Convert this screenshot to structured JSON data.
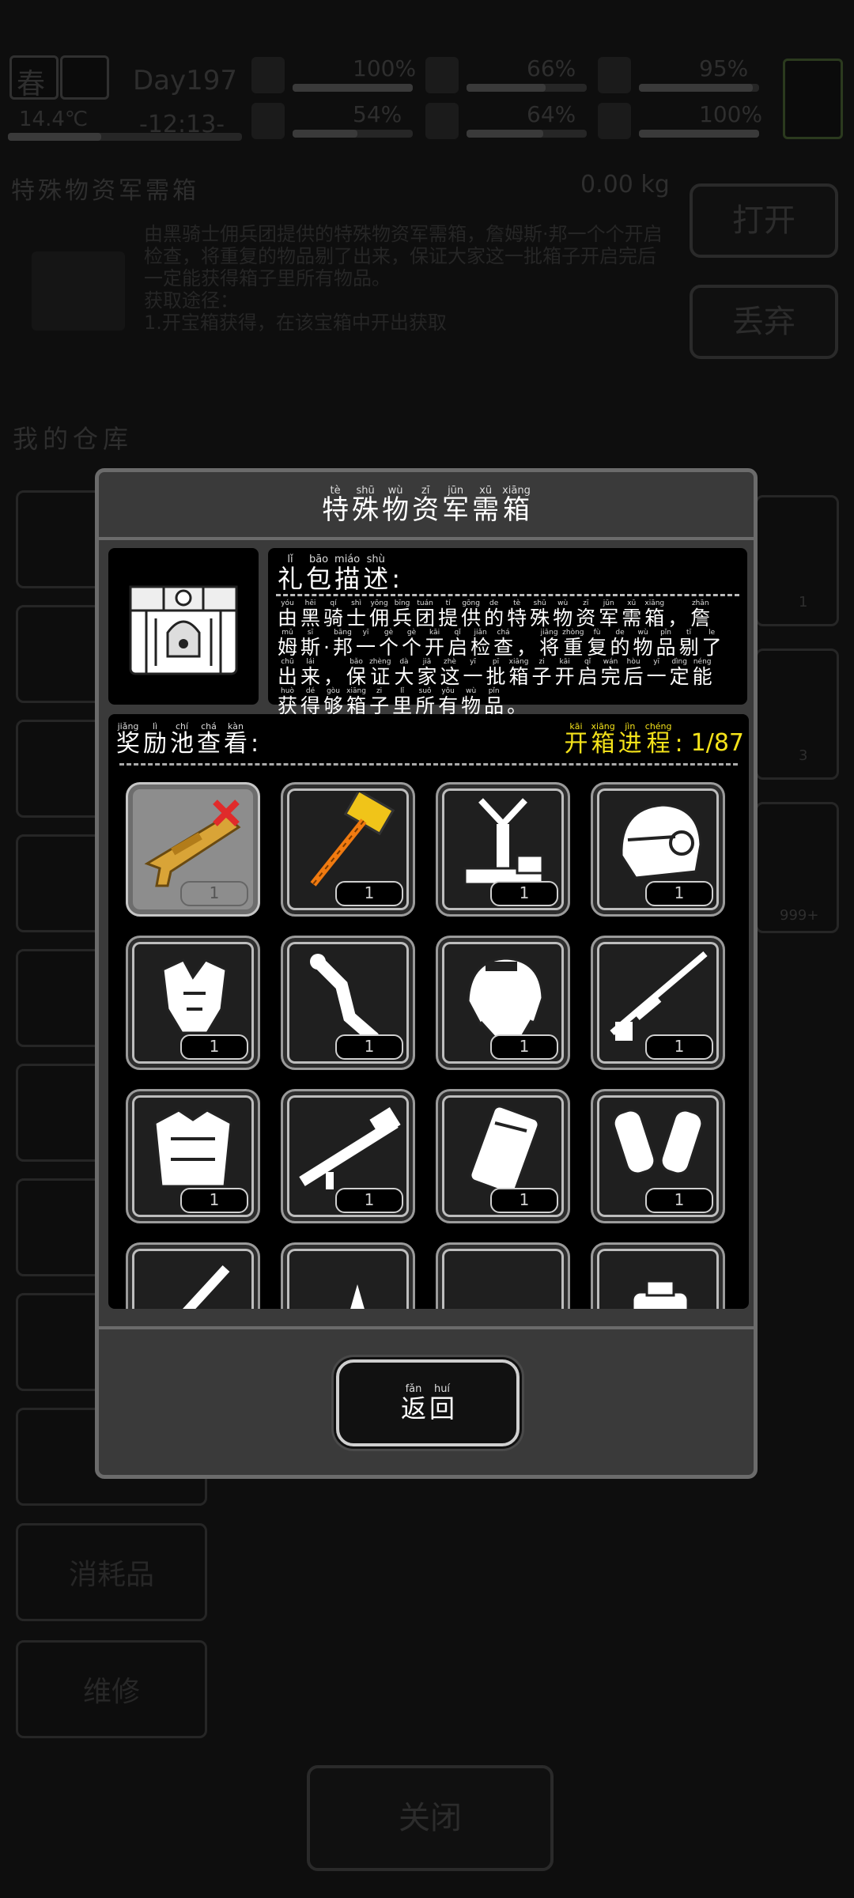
{
  "hud": {
    "season": "春",
    "day": "Day197",
    "temperature": "14.4℃",
    "time": "-12:13-",
    "stats": [
      {
        "name": "health",
        "value": "100%",
        "level": 1.0
      },
      {
        "name": "food",
        "value": "66%",
        "level": 0.66
      },
      {
        "name": "mood",
        "value": "95%",
        "level": 0.95
      },
      {
        "name": "stamina",
        "value": "54%",
        "level": 0.54
      },
      {
        "name": "water",
        "value": "64%",
        "level": 0.64
      },
      {
        "name": "heart",
        "value": "100%",
        "level": 1.0
      }
    ]
  },
  "background": {
    "item_title": "特殊物资军需箱",
    "weight": "0.00 kg",
    "open_button": "打开",
    "discard_button": "丢弃",
    "description": "由黑骑士佣兵团提供的特殊物资军需箱，詹姆斯·邦一个个开启检查，将重复的物品剔了出来，保证大家这一批箱子开启完后一定能获得箱子里所有物品。",
    "source_label": "获取途径：",
    "source_text": "1.开宝箱获得，在该宝箱中开出获取",
    "warehouse_title": "我的仓库",
    "side_items": [
      "消耗品",
      "维修"
    ],
    "right_badges": [
      "1",
      "3",
      "999+"
    ],
    "close_button": "关闭"
  },
  "modal": {
    "title": [
      {
        "py": "tè",
        "hz": "特"
      },
      {
        "py": "shū",
        "hz": "殊"
      },
      {
        "py": "wù",
        "hz": "物"
      },
      {
        "py": "zī",
        "hz": "资"
      },
      {
        "py": "jūn",
        "hz": "军"
      },
      {
        "py": "xū",
        "hz": "需"
      },
      {
        "py": "xiāng",
        "hz": "箱"
      }
    ],
    "desc_label": [
      {
        "py": "lǐ",
        "hz": "礼"
      },
      {
        "py": "bāo",
        "hz": "包"
      },
      {
        "py": "miáo",
        "hz": "描"
      },
      {
        "py": "shù",
        "hz": "述"
      },
      {
        "py": "",
        "hz": ":"
      }
    ],
    "description_lines": [
      [
        {
          "py": "yóu",
          "hz": "由"
        },
        {
          "py": "hēi",
          "hz": "黑"
        },
        {
          "py": "qí",
          "hz": "骑"
        },
        {
          "py": "shì",
          "hz": "士"
        },
        {
          "py": "yōng",
          "hz": "佣"
        },
        {
          "py": "bīng",
          "hz": "兵"
        },
        {
          "py": "tuán",
          "hz": "团"
        },
        {
          "py": "tí",
          "hz": "提"
        },
        {
          "py": "gōng",
          "hz": "供"
        },
        {
          "py": "de",
          "hz": "的"
        },
        {
          "py": "tè",
          "hz": "特"
        },
        {
          "py": "shū",
          "hz": "殊"
        },
        {
          "py": "wù",
          "hz": "物"
        },
        {
          "py": "zī",
          "hz": "资"
        },
        {
          "py": "jūn",
          "hz": "军"
        },
        {
          "py": "xū",
          "hz": "需"
        },
        {
          "py": "xiāng",
          "hz": "箱"
        },
        {
          "py": "",
          "hz": "，"
        },
        {
          "py": "zhān",
          "hz": "詹"
        }
      ],
      [
        {
          "py": "mǔ",
          "hz": "姆"
        },
        {
          "py": "sī",
          "hz": "斯"
        },
        {
          "py": "",
          "hz": "·"
        },
        {
          "py": "bāng",
          "hz": "邦"
        },
        {
          "py": "yī",
          "hz": "一"
        },
        {
          "py": "gè",
          "hz": "个"
        },
        {
          "py": "gè",
          "hz": "个"
        },
        {
          "py": "kāi",
          "hz": "开"
        },
        {
          "py": "qǐ",
          "hz": "启"
        },
        {
          "py": "jiǎn",
          "hz": "检"
        },
        {
          "py": "chá",
          "hz": "查"
        },
        {
          "py": "",
          "hz": "，"
        },
        {
          "py": "jiāng",
          "hz": "将"
        },
        {
          "py": "zhòng",
          "hz": "重"
        },
        {
          "py": "fù",
          "hz": "复"
        },
        {
          "py": "de",
          "hz": "的"
        },
        {
          "py": "wù",
          "hz": "物"
        },
        {
          "py": "pǐn",
          "hz": "品"
        },
        {
          "py": "tī",
          "hz": "剔"
        },
        {
          "py": "le",
          "hz": "了"
        }
      ],
      [
        {
          "py": "chū",
          "hz": "出"
        },
        {
          "py": "lái",
          "hz": "来"
        },
        {
          "py": "",
          "hz": "，"
        },
        {
          "py": "bǎo",
          "hz": "保"
        },
        {
          "py": "zhèng",
          "hz": "证"
        },
        {
          "py": "dà",
          "hz": "大"
        },
        {
          "py": "jiā",
          "hz": "家"
        },
        {
          "py": "zhè",
          "hz": "这"
        },
        {
          "py": "yī",
          "hz": "一"
        },
        {
          "py": "pī",
          "hz": "批"
        },
        {
          "py": "xiāng",
          "hz": "箱"
        },
        {
          "py": "zi",
          "hz": "子"
        },
        {
          "py": "kāi",
          "hz": "开"
        },
        {
          "py": "qǐ",
          "hz": "启"
        },
        {
          "py": "wán",
          "hz": "完"
        },
        {
          "py": "hòu",
          "hz": "后"
        },
        {
          "py": "yī",
          "hz": "一"
        },
        {
          "py": "dìng",
          "hz": "定"
        },
        {
          "py": "néng",
          "hz": "能"
        }
      ],
      [
        {
          "py": "huò",
          "hz": "获"
        },
        {
          "py": "dé",
          "hz": "得"
        },
        {
          "py": "gòu",
          "hz": "够"
        },
        {
          "py": "xiāng",
          "hz": "箱"
        },
        {
          "py": "zi",
          "hz": "子"
        },
        {
          "py": "lǐ",
          "hz": "里"
        },
        {
          "py": "suǒ",
          "hz": "所"
        },
        {
          "py": "yǒu",
          "hz": "有"
        },
        {
          "py": "wù",
          "hz": "物"
        },
        {
          "py": "pǐn",
          "hz": "品"
        },
        {
          "py": "",
          "hz": "。"
        }
      ]
    ],
    "pool_label": [
      {
        "py": "jiǎng",
        "hz": "奖"
      },
      {
        "py": "lì",
        "hz": "励"
      },
      {
        "py": "chí",
        "hz": "池"
      },
      {
        "py": "chá",
        "hz": "查"
      },
      {
        "py": "kàn",
        "hz": "看"
      },
      {
        "py": "",
        "hz": ":"
      }
    ],
    "progress_label": [
      {
        "py": "kāi",
        "hz": "开"
      },
      {
        "py": "xiāng",
        "hz": "箱"
      },
      {
        "py": "jìn",
        "hz": "进"
      },
      {
        "py": "chéng",
        "hz": "程"
      },
      {
        "py": "",
        "hz": ":"
      }
    ],
    "progress_value": "1/87",
    "rewards": [
      {
        "icon": "grenade-launcher-icon",
        "count": "1",
        "selected": true
      },
      {
        "icon": "sledgehammer-icon",
        "count": "1"
      },
      {
        "icon": "turret-stand-icon",
        "count": "1"
      },
      {
        "icon": "combat-helmet-icon",
        "count": "1"
      },
      {
        "icon": "shoulder-armor-icon",
        "count": "1"
      },
      {
        "icon": "bone-weapon-icon",
        "count": "1"
      },
      {
        "icon": "tactical-helmet-icon",
        "count": "1"
      },
      {
        "icon": "sniper-rifle-icon",
        "count": "1"
      },
      {
        "icon": "body-armor-icon",
        "count": "1"
      },
      {
        "icon": "rocket-launcher-icon",
        "count": "1"
      },
      {
        "icon": "shield-plate-icon",
        "count": "1"
      },
      {
        "icon": "arm-guards-icon",
        "count": "1"
      },
      {
        "icon": "minigun-icon",
        "count": ""
      },
      {
        "icon": "power-drill-icon",
        "count": ""
      },
      {
        "icon": "chain-blade-icon",
        "count": ""
      },
      {
        "icon": "backpack-icon",
        "count": ""
      }
    ],
    "back_button": [
      {
        "py": "fǎn",
        "hz": "返"
      },
      {
        "py": "huí",
        "hz": "回"
      }
    ]
  }
}
